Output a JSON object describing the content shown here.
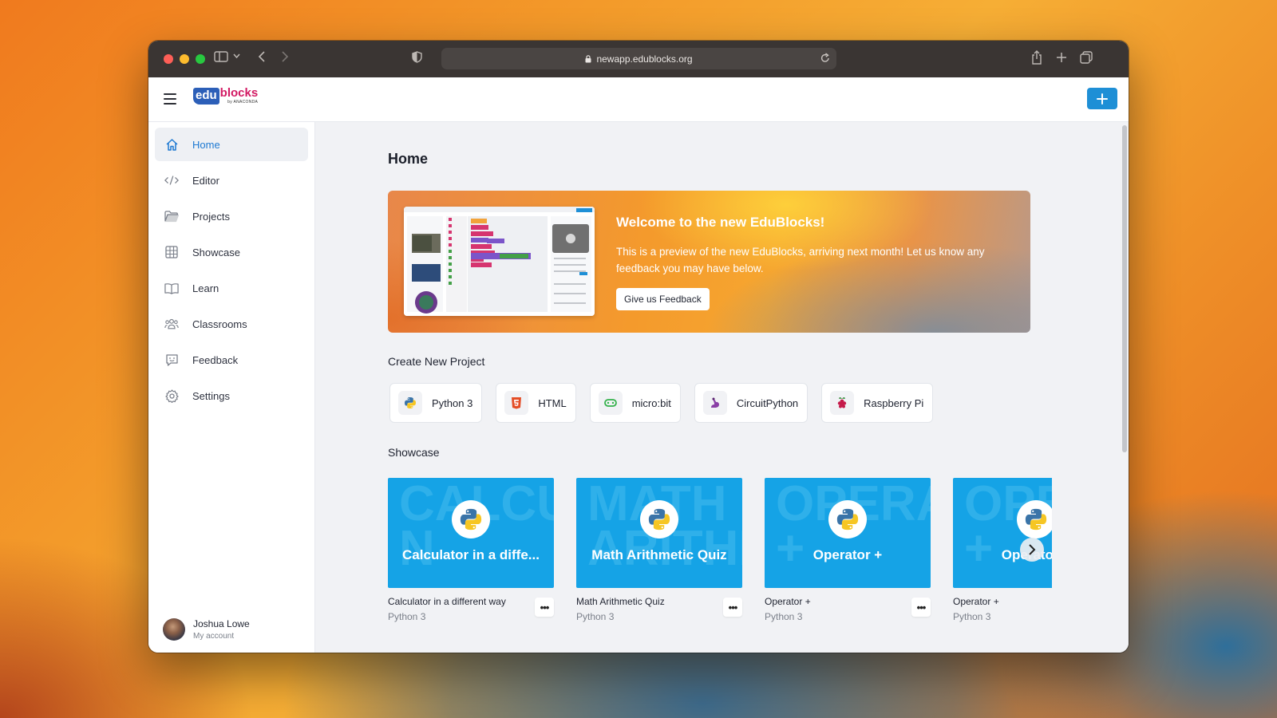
{
  "browser": {
    "url": "newapp.edublocks.org"
  },
  "header": {
    "logo_prefix": "edu",
    "logo_word": "blocks",
    "logo_sub": "by ANACONDA"
  },
  "sidebar": {
    "items": [
      {
        "label": "Home",
        "icon": "home-icon",
        "active": true
      },
      {
        "label": "Editor",
        "icon": "code-icon"
      },
      {
        "label": "Projects",
        "icon": "folder-icon"
      },
      {
        "label": "Showcase",
        "icon": "grid-icon"
      },
      {
        "label": "Learn",
        "icon": "book-icon"
      },
      {
        "label": "Classrooms",
        "icon": "people-icon"
      },
      {
        "label": "Feedback",
        "icon": "chat-icon"
      },
      {
        "label": "Settings",
        "icon": "gear-icon"
      }
    ],
    "account": {
      "name": "Joshua Lowe",
      "sub": "My account"
    }
  },
  "main": {
    "title": "Home",
    "banner": {
      "title": "Welcome to the new EduBlocks!",
      "text": "This is a preview of the new EduBlocks, arriving next month! Let us know any feedback you may have below.",
      "button": "Give us Feedback"
    },
    "create_label": "Create New Project",
    "project_types": [
      {
        "label": "Python 3",
        "icon": "python-icon"
      },
      {
        "label": "HTML",
        "icon": "html5-icon"
      },
      {
        "label": "micro:bit",
        "icon": "microbit-icon"
      },
      {
        "label": "CircuitPython",
        "icon": "circuitpython-icon"
      },
      {
        "label": "Raspberry Pi",
        "icon": "raspberry-pi-icon"
      }
    ],
    "showcase_label": "Showcase",
    "showcase": [
      {
        "thumb_title": "Calculator in a diffe...",
        "bg1": "CALCU",
        "bg2": "N",
        "name": "Calculator in a different way",
        "lang": "Python 3"
      },
      {
        "thumb_title": "Math Arithmetic Quiz",
        "bg1": "MATH",
        "bg2": "ARITHM",
        "name": "Math Arithmetic Quiz",
        "lang": "Python 3"
      },
      {
        "thumb_title": "Operator +",
        "bg1": "OPERA",
        "bg2": "+",
        "name": "Operator +",
        "lang": "Python 3"
      },
      {
        "thumb_title": "Operator +",
        "bg1": "OPERA",
        "bg2": "+",
        "name": "Operator +",
        "lang": "Python 3"
      }
    ],
    "more_label": "•••"
  },
  "colors": {
    "accent": "#1d79d2",
    "add_button": "#1e8fd6",
    "card_blue": "#15a3e6"
  }
}
